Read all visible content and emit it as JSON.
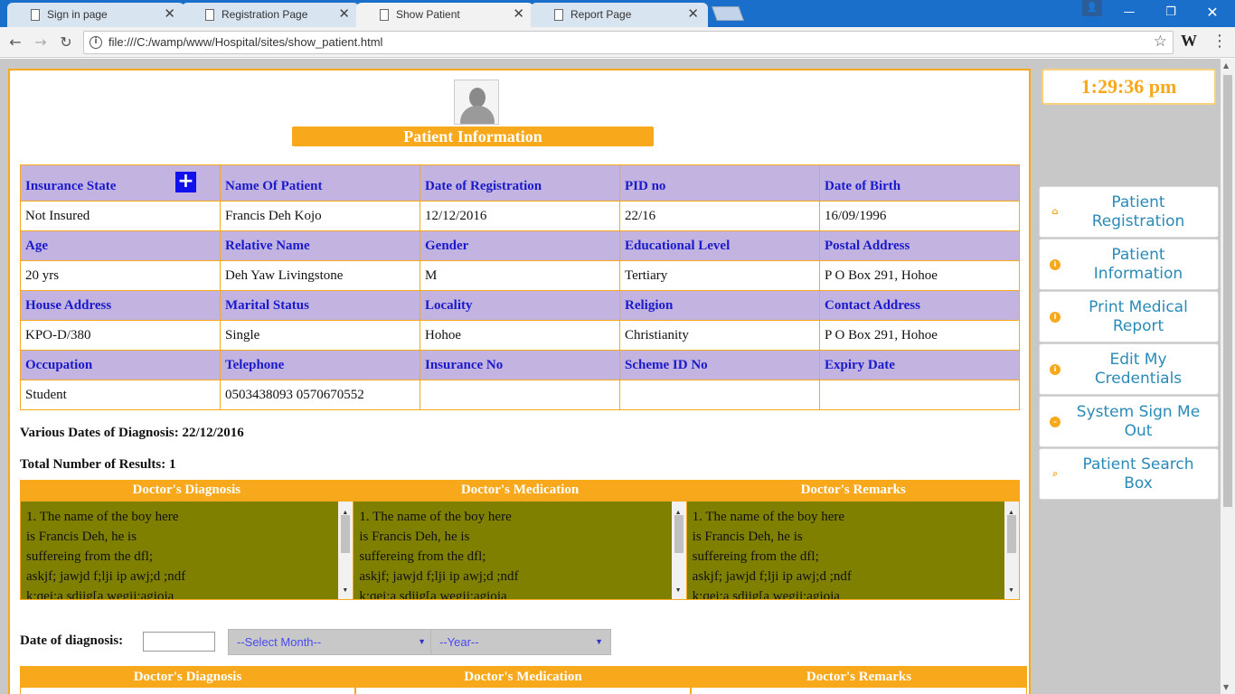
{
  "browser": {
    "tabs": [
      {
        "title": "Sign in page"
      },
      {
        "title": "Registration Page"
      },
      {
        "title": "Show Patient"
      },
      {
        "title": "Report Page"
      }
    ],
    "url": "file:///C:/wamp/www/Hospital/sites/show_patient.html",
    "ext_label": "W"
  },
  "page": {
    "title": "Patient Information",
    "table": {
      "rows": [
        {
          "headers": [
            "Insurance State",
            "Name Of Patient",
            "Date of Registration",
            "PID no",
            "Date of Birth"
          ],
          "values": [
            "Not Insured",
            "Francis Deh Kojo",
            "12/12/2016",
            "22/16",
            "16/09/1996"
          ]
        },
        {
          "headers": [
            "Age",
            "Relative Name",
            "Gender",
            "Educational Level",
            "Postal Address"
          ],
          "values": [
            "20 yrs",
            "Deh Yaw Livingstone",
            "M",
            "Tertiary",
            "P O Box 291, Hohoe"
          ]
        },
        {
          "headers": [
            "House Address",
            "Marital Status",
            "Locality",
            "Religion",
            "Contact Address"
          ],
          "values": [
            "KPO-D/380",
            "Single",
            "Hohoe",
            "Christianity",
            "P O Box 291, Hohoe"
          ]
        },
        {
          "headers": [
            "Occupation",
            "Telephone",
            "Insurance No",
            "Scheme ID No",
            "Expiry Date"
          ],
          "values": [
            "Student",
            "0503438093 0570670552",
            "",
            "",
            ""
          ]
        }
      ]
    },
    "dates_line": "Various Dates of Diagnosis: 22/12/2016",
    "total_line": "Total Number of Results: 1",
    "diag_headers": [
      "Doctor's Diagnosis",
      "Doctor's Medication",
      "Doctor's Remarks"
    ],
    "diag_text_lines": [
      "1. The name of the boy here",
      "is Francis Deh, he is",
      "suffereing from the dfl;",
      "askjf; jawjd f;lji ip awj;d ;ndf",
      "k;qei;a sdjig[a wegij;agioja"
    ],
    "date_of_diagnosis_label": "Date of diagnosis:",
    "month_select": "--Select Month--",
    "year_select": "--Year--",
    "diag_headers_2": [
      "Doctor's Diagnosis",
      "Doctor's Medication",
      "Doctor's Remarks"
    ]
  },
  "sidebar": {
    "clock": "1:29:36 pm",
    "items": [
      {
        "label": "Patient Registration",
        "icon": "home-icon"
      },
      {
        "label": "Patient Information",
        "icon": "info-icon"
      },
      {
        "label": "Print Medical Report",
        "icon": "info-icon"
      },
      {
        "label": "Edit My Credentials",
        "icon": "info-icon"
      },
      {
        "label": "System Sign Me Out",
        "icon": "minus-circle-icon"
      },
      {
        "label": "Patient Search Box",
        "icon": "search-icon"
      }
    ]
  },
  "colors": {
    "accent": "#f7a81b",
    "header_cell": "#c3b3e0",
    "header_text": "#1a1acc",
    "diagnosis_bg": "#808000",
    "link_blue": "#2a8ab8"
  }
}
